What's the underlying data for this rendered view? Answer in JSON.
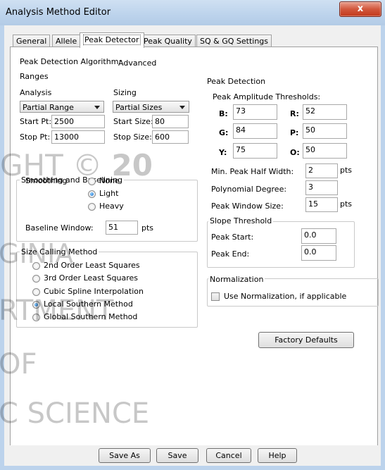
{
  "window": {
    "title": "Analysis Method Editor",
    "close_label": "x"
  },
  "tabs": [
    {
      "label": "General"
    },
    {
      "label": "Allele"
    },
    {
      "label": "Peak Detector"
    },
    {
      "label": "Peak Quality"
    },
    {
      "label": "SQ & GQ Settings"
    }
  ],
  "algorithm": {
    "label": "Peak Detection Algorithm:",
    "value": "Advanced"
  },
  "ranges": {
    "legend": "Ranges",
    "analysis_label": "Analysis",
    "analysis_value": "Partial Range",
    "sizing_label": "Sizing",
    "sizing_value": "Partial Sizes",
    "start_pt_label": "Start Pt:",
    "start_pt_value": "2500",
    "stop_pt_label": "Stop Pt:",
    "stop_pt_value": "13000",
    "start_size_label": "Start Size:",
    "start_size_value": "80",
    "stop_size_label": "Stop Size:",
    "stop_size_value": "600"
  },
  "smoothing": {
    "legend": "Smoothing and Baselining",
    "label": "Smoothing",
    "options": [
      "None",
      "Light",
      "Heavy"
    ],
    "selected": "Light",
    "baseline_label": "Baseline Window:",
    "baseline_value": "51",
    "baseline_unit": "pts"
  },
  "size_calling": {
    "legend": "Size Calling Method",
    "options": [
      "2nd Order Least Squares",
      "3rd Order Least Squares",
      "Cubic Spline Interpolation",
      "Local Southern Method",
      "Global Southern Method"
    ],
    "selected": "Local Southern Method"
  },
  "peak_detection": {
    "legend": "Peak Detection",
    "thresholds_label": "Peak Amplitude Thresholds:",
    "B_label": "B:",
    "B_value": "73",
    "R_label": "R:",
    "R_value": "52",
    "G_label": "G:",
    "G_value": "84",
    "P_label": "P:",
    "P_value": "50",
    "Y_label": "Y:",
    "Y_value": "75",
    "O_label": "O:",
    "O_value": "50",
    "min_half_width_label": "Min. Peak Half Width:",
    "min_half_width_value": "2",
    "min_half_width_unit": "pts",
    "poly_degree_label": "Polynomial Degree:",
    "poly_degree_value": "3",
    "window_size_label": "Peak Window Size:",
    "window_size_value": "15",
    "window_size_unit": "pts"
  },
  "slope": {
    "legend": "Slope Threshold",
    "start_label": "Peak Start:",
    "start_value": "0.0",
    "end_label": "Peak End:",
    "end_value": "0.0"
  },
  "normalization": {
    "legend": "Normalization",
    "checkbox_label": "Use Normalization, if applicable",
    "checked": false
  },
  "factory_defaults_label": "Factory Defaults",
  "buttons": {
    "save_as": "Save As",
    "save": "Save",
    "cancel": "Cancel",
    "help": "Help"
  },
  "watermark": {
    "line1": "GHT © 20",
    "line1_bold": "20",
    "line2": "GINIA",
    "line3": "RTMENT",
    "line4": "OF",
    "line5": "C SCIENCE"
  }
}
